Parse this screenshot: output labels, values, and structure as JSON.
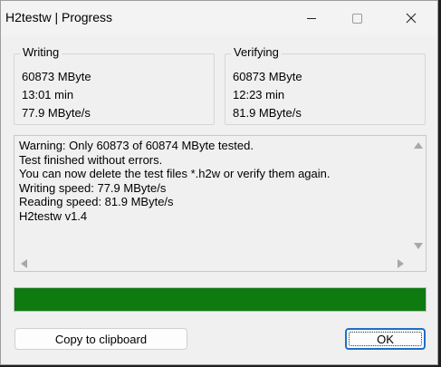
{
  "window": {
    "title": "H2testw | Progress"
  },
  "writing": {
    "label": "Writing",
    "size": "60873 MByte",
    "time": "13:01 min",
    "speed": "77.9 MByte/s"
  },
  "verifying": {
    "label": "Verifying",
    "size": "60873 MByte",
    "time": "12:23 min",
    "speed": "81.9 MByte/s"
  },
  "log": {
    "lines": [
      "Warning: Only 60873 of 60874 MByte tested.",
      "Test finished without errors.",
      "You can now delete the test files *.h2w or verify them again.",
      "Writing speed: 77.9 MByte/s",
      "Reading speed: 81.9 MByte/s",
      "H2testw v1.4"
    ]
  },
  "progress": {
    "fraction": 1.0,
    "color": "#0e7a10"
  },
  "buttons": {
    "copy_label": "Copy to clipboard",
    "ok_label": "OK"
  },
  "icons": {
    "minimize": "minimize-icon",
    "maximize": "maximize-icon",
    "close": "close-icon"
  }
}
